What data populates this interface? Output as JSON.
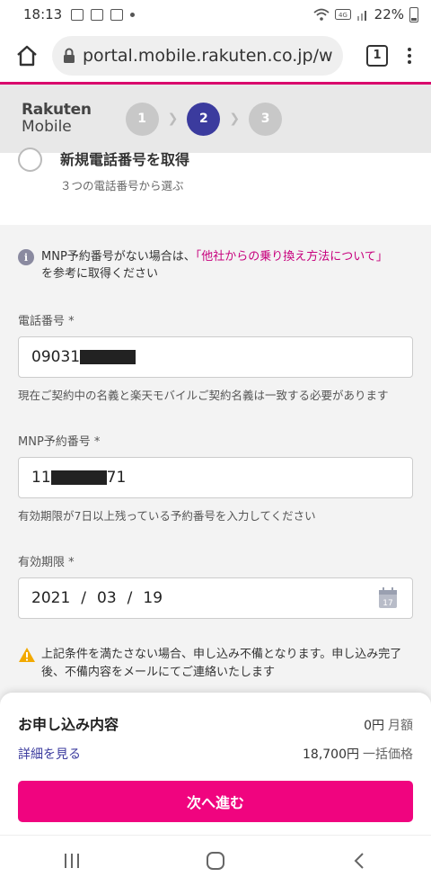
{
  "status_bar": {
    "time": "18:13",
    "battery": "22%"
  },
  "browser": {
    "url": "portal.mobile.rakuten.co.jp/w",
    "tab_count": "1"
  },
  "header": {
    "logo_line1": "Rakuten",
    "logo_line2": "Mobile",
    "steps": [
      "1",
      "2",
      "3"
    ],
    "active_step": "2"
  },
  "number_option": {
    "label": "新規電話番号を取得",
    "sub": "３つの電話番号から選ぶ"
  },
  "mnp_info": {
    "prefix": "MNP予約番号がない場合は、",
    "link": "「他社からの乗り換え方法について」",
    "suffix": "を参考に取得ください"
  },
  "phone_field": {
    "label": "電話番号 *",
    "value_visible": "09031",
    "help": "現在ご契約中の名義と楽天モバイルご契約名義は一致する必要があります"
  },
  "mnp_field": {
    "label": "MNP予約番号 *",
    "value_prefix": "11",
    "value_suffix": "71",
    "help": "有効期限が7日以上残っている予約番号を入力してください"
  },
  "expiry_field": {
    "label": "有効期限 *",
    "year": "2021",
    "month": "03",
    "day": "19",
    "separator": "/",
    "calendar_day": "17"
  },
  "warning": {
    "text": "上記条件を満たさない場合、申し込み不備となります。申し込み完了後、不備内容をメールにてご連絡いたします"
  },
  "summary": {
    "title": "お申し込み内容",
    "monthly_price": "0円",
    "monthly_unit": "月額",
    "details_link": "詳細を見る",
    "lump_price": "18,700円",
    "lump_unit": "一括価格",
    "next_button": "次へ進む"
  },
  "colors": {
    "brand_pink": "#f0047f",
    "step_active": "#3b3b9e",
    "link_magenta": "#c7007d"
  }
}
